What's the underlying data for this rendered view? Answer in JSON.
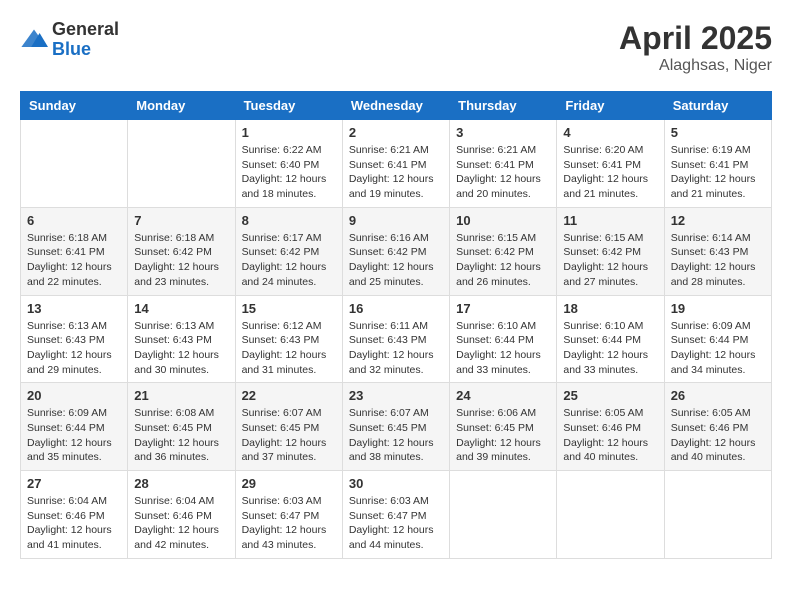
{
  "logo": {
    "general": "General",
    "blue": "Blue"
  },
  "header": {
    "month": "April 2025",
    "location": "Alaghsas, Niger"
  },
  "weekdays": [
    "Sunday",
    "Monday",
    "Tuesday",
    "Wednesday",
    "Thursday",
    "Friday",
    "Saturday"
  ],
  "weeks": [
    [
      {
        "day": "",
        "info": ""
      },
      {
        "day": "",
        "info": ""
      },
      {
        "day": "1",
        "info": "Sunrise: 6:22 AM\nSunset: 6:40 PM\nDaylight: 12 hours and 18 minutes."
      },
      {
        "day": "2",
        "info": "Sunrise: 6:21 AM\nSunset: 6:41 PM\nDaylight: 12 hours and 19 minutes."
      },
      {
        "day": "3",
        "info": "Sunrise: 6:21 AM\nSunset: 6:41 PM\nDaylight: 12 hours and 20 minutes."
      },
      {
        "day": "4",
        "info": "Sunrise: 6:20 AM\nSunset: 6:41 PM\nDaylight: 12 hours and 21 minutes."
      },
      {
        "day": "5",
        "info": "Sunrise: 6:19 AM\nSunset: 6:41 PM\nDaylight: 12 hours and 21 minutes."
      }
    ],
    [
      {
        "day": "6",
        "info": "Sunrise: 6:18 AM\nSunset: 6:41 PM\nDaylight: 12 hours and 22 minutes."
      },
      {
        "day": "7",
        "info": "Sunrise: 6:18 AM\nSunset: 6:42 PM\nDaylight: 12 hours and 23 minutes."
      },
      {
        "day": "8",
        "info": "Sunrise: 6:17 AM\nSunset: 6:42 PM\nDaylight: 12 hours and 24 minutes."
      },
      {
        "day": "9",
        "info": "Sunrise: 6:16 AM\nSunset: 6:42 PM\nDaylight: 12 hours and 25 minutes."
      },
      {
        "day": "10",
        "info": "Sunrise: 6:15 AM\nSunset: 6:42 PM\nDaylight: 12 hours and 26 minutes."
      },
      {
        "day": "11",
        "info": "Sunrise: 6:15 AM\nSunset: 6:42 PM\nDaylight: 12 hours and 27 minutes."
      },
      {
        "day": "12",
        "info": "Sunrise: 6:14 AM\nSunset: 6:43 PM\nDaylight: 12 hours and 28 minutes."
      }
    ],
    [
      {
        "day": "13",
        "info": "Sunrise: 6:13 AM\nSunset: 6:43 PM\nDaylight: 12 hours and 29 minutes."
      },
      {
        "day": "14",
        "info": "Sunrise: 6:13 AM\nSunset: 6:43 PM\nDaylight: 12 hours and 30 minutes."
      },
      {
        "day": "15",
        "info": "Sunrise: 6:12 AM\nSunset: 6:43 PM\nDaylight: 12 hours and 31 minutes."
      },
      {
        "day": "16",
        "info": "Sunrise: 6:11 AM\nSunset: 6:43 PM\nDaylight: 12 hours and 32 minutes."
      },
      {
        "day": "17",
        "info": "Sunrise: 6:10 AM\nSunset: 6:44 PM\nDaylight: 12 hours and 33 minutes."
      },
      {
        "day": "18",
        "info": "Sunrise: 6:10 AM\nSunset: 6:44 PM\nDaylight: 12 hours and 33 minutes."
      },
      {
        "day": "19",
        "info": "Sunrise: 6:09 AM\nSunset: 6:44 PM\nDaylight: 12 hours and 34 minutes."
      }
    ],
    [
      {
        "day": "20",
        "info": "Sunrise: 6:09 AM\nSunset: 6:44 PM\nDaylight: 12 hours and 35 minutes."
      },
      {
        "day": "21",
        "info": "Sunrise: 6:08 AM\nSunset: 6:45 PM\nDaylight: 12 hours and 36 minutes."
      },
      {
        "day": "22",
        "info": "Sunrise: 6:07 AM\nSunset: 6:45 PM\nDaylight: 12 hours and 37 minutes."
      },
      {
        "day": "23",
        "info": "Sunrise: 6:07 AM\nSunset: 6:45 PM\nDaylight: 12 hours and 38 minutes."
      },
      {
        "day": "24",
        "info": "Sunrise: 6:06 AM\nSunset: 6:45 PM\nDaylight: 12 hours and 39 minutes."
      },
      {
        "day": "25",
        "info": "Sunrise: 6:05 AM\nSunset: 6:46 PM\nDaylight: 12 hours and 40 minutes."
      },
      {
        "day": "26",
        "info": "Sunrise: 6:05 AM\nSunset: 6:46 PM\nDaylight: 12 hours and 40 minutes."
      }
    ],
    [
      {
        "day": "27",
        "info": "Sunrise: 6:04 AM\nSunset: 6:46 PM\nDaylight: 12 hours and 41 minutes."
      },
      {
        "day": "28",
        "info": "Sunrise: 6:04 AM\nSunset: 6:46 PM\nDaylight: 12 hours and 42 minutes."
      },
      {
        "day": "29",
        "info": "Sunrise: 6:03 AM\nSunset: 6:47 PM\nDaylight: 12 hours and 43 minutes."
      },
      {
        "day": "30",
        "info": "Sunrise: 6:03 AM\nSunset: 6:47 PM\nDaylight: 12 hours and 44 minutes."
      },
      {
        "day": "",
        "info": ""
      },
      {
        "day": "",
        "info": ""
      },
      {
        "day": "",
        "info": ""
      }
    ]
  ]
}
